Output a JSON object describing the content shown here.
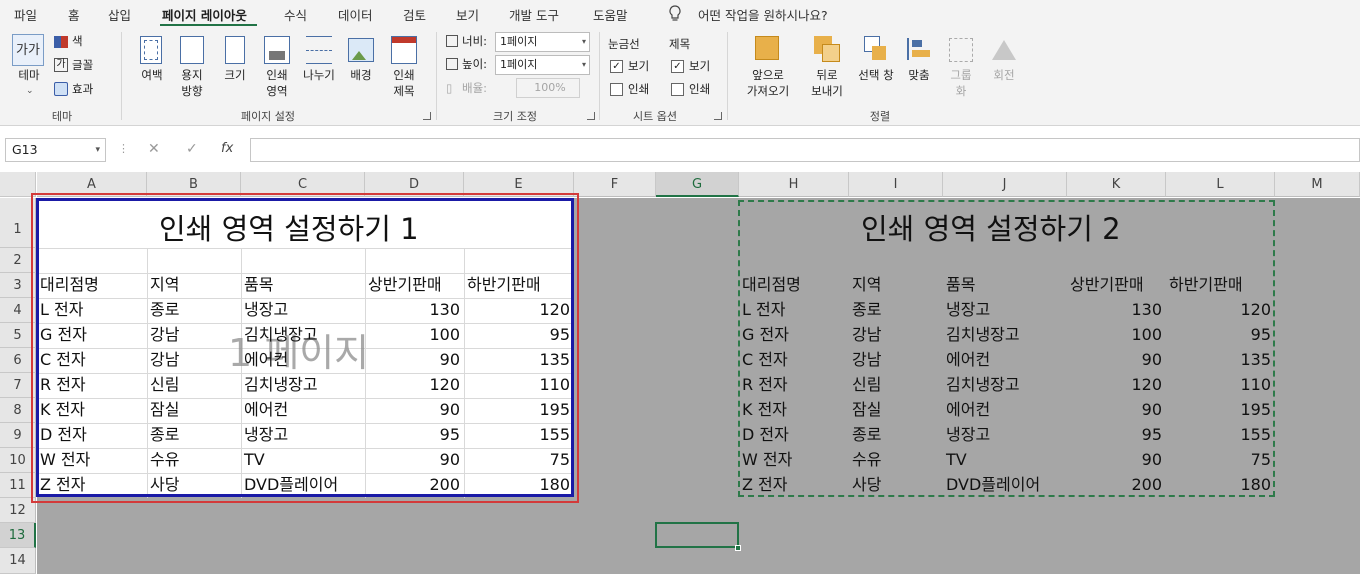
{
  "tabs": [
    "파일",
    "홈",
    "삽입",
    "페이지 레이아웃",
    "수식",
    "데이터",
    "검토",
    "보기",
    "개발 도구",
    "도움말"
  ],
  "tell_me": "어떤 작업을 원하시나요?",
  "ribbon": {
    "theme": {
      "themes": "테마",
      "colors": "색",
      "fonts": "글꼴",
      "effects": "효과",
      "group": "테마"
    },
    "page_setup": {
      "margins": "여백",
      "orientation_1": "용지",
      "orientation_2": "방향",
      "size": "크기",
      "print_area_1": "인쇄",
      "print_area_2": "영역",
      "breaks": "나누기",
      "background": "배경",
      "print_titles_1": "인쇄",
      "print_titles_2": "제목",
      "group": "페이지 설정"
    },
    "scale": {
      "width_label": "너비:",
      "width_value": "1페이지",
      "height_label": "높이:",
      "height_value": "1페이지",
      "scale_label": "배율:",
      "scale_value": "100%",
      "group": "크기 조정"
    },
    "sheet_options": {
      "gridlines": "눈금선",
      "headings": "제목",
      "view": "보기",
      "print": "인쇄",
      "group": "시트 옵션"
    },
    "arrange": {
      "bring_forward_1": "앞으로",
      "bring_forward_2": "가져오기",
      "send_backward_1": "뒤로",
      "send_backward_2": "보내기",
      "selection_pane": "선택 창",
      "align": "맞춤",
      "group_1": "그룹",
      "group_2": "화",
      "rotate": "회전",
      "group": "정렬"
    }
  },
  "formula_bar": {
    "name_box": "G13",
    "cancel": "✕",
    "enter": "✓",
    "fx": "fx"
  },
  "columns": [
    "A",
    "B",
    "C",
    "D",
    "E",
    "F",
    "G",
    "H",
    "I",
    "J",
    "K",
    "L",
    "M"
  ],
  "rows": [
    "1",
    "2",
    "3",
    "4",
    "5",
    "6",
    "7",
    "8",
    "9",
    "10",
    "11",
    "12",
    "13",
    "14"
  ],
  "selected_cell": "G13",
  "table1": {
    "title": "인쇄 영역 설정하기 1",
    "headers": [
      "대리점명",
      "지역",
      "품목",
      "상반기판매",
      "하반기판매"
    ],
    "rows": [
      [
        "L 전자",
        "종로",
        "냉장고",
        "130",
        "120"
      ],
      [
        "G 전자",
        "강남",
        "김치냉장고",
        "100",
        "95"
      ],
      [
        "C 전자",
        "강남",
        "에어컨",
        "90",
        "135"
      ],
      [
        "R 전자",
        "신림",
        "김치냉장고",
        "120",
        "110"
      ],
      [
        "K 전자",
        "잠실",
        "에어컨",
        "90",
        "195"
      ],
      [
        "D 전자",
        "종로",
        "냉장고",
        "95",
        "155"
      ],
      [
        "W 전자",
        "수유",
        "TV",
        "90",
        "75"
      ],
      [
        "Z 전자",
        "사당",
        "DVD플레이어",
        "200",
        "180"
      ]
    ]
  },
  "page_watermark": "1 페이지",
  "table2": {
    "title": "인쇄 영역 설정하기 2",
    "headers": [
      "대리점명",
      "지역",
      "품목",
      "상반기판매",
      "하반기판매"
    ],
    "rows": [
      [
        "L 전자",
        "종로",
        "냉장고",
        "130",
        "120"
      ],
      [
        "G 전자",
        "강남",
        "김치냉장고",
        "100",
        "95"
      ],
      [
        "C 전자",
        "강남",
        "에어컨",
        "90",
        "135"
      ],
      [
        "R 전자",
        "신림",
        "김치냉장고",
        "120",
        "110"
      ],
      [
        "K 전자",
        "잠실",
        "에어컨",
        "90",
        "195"
      ],
      [
        "D 전자",
        "종로",
        "냉장고",
        "95",
        "155"
      ],
      [
        "W 전자",
        "수유",
        "TV",
        "90",
        "75"
      ],
      [
        "Z 전자",
        "사당",
        "DVD플레이어",
        "200",
        "180"
      ]
    ]
  }
}
